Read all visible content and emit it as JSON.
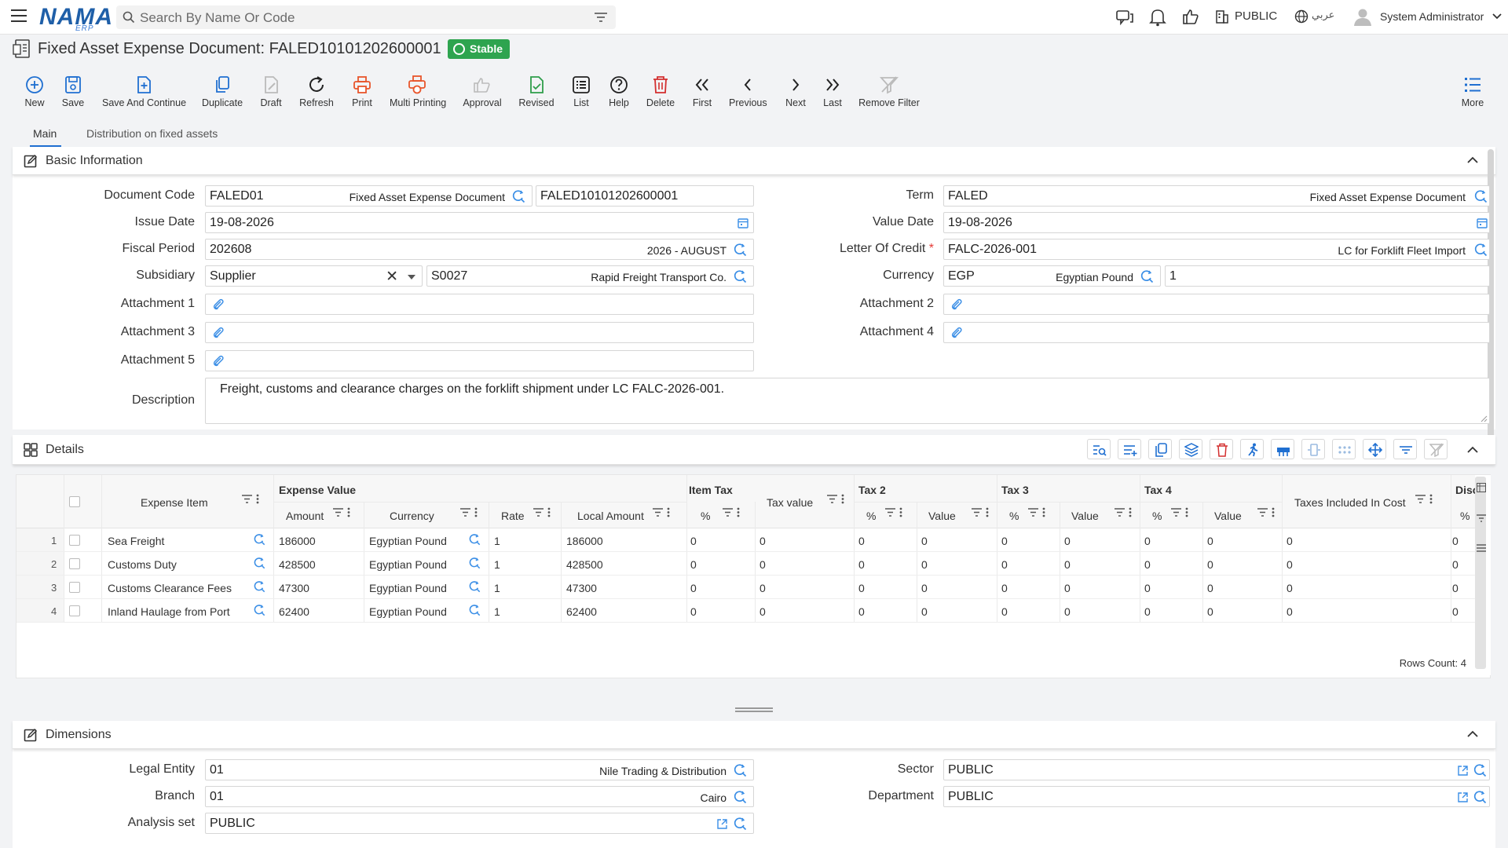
{
  "topbar": {
    "logo": "NAMA",
    "logo_sub": "ERP",
    "search_placeholder": "Search By Name Or Code",
    "company": "PUBLIC",
    "language": "عربي",
    "user": "System Administrator"
  },
  "doc": {
    "title": "Fixed Asset Expense Document: FALED10101202600001",
    "status": "Stable"
  },
  "toolbar": {
    "new": "New",
    "save": "Save",
    "save_continue": "Save And Continue",
    "duplicate": "Duplicate",
    "draft": "Draft",
    "refresh": "Refresh",
    "print": "Print",
    "multi_printing": "Multi Printing",
    "approval": "Approval",
    "revised": "Revised",
    "list": "List",
    "help": "Help",
    "delete": "Delete",
    "first": "First",
    "previous": "Previous",
    "next": "Next",
    "last": "Last",
    "remove_filter": "Remove Filter",
    "more": "More"
  },
  "tabs": {
    "main": "Main",
    "distribution": "Distribution on fixed assets"
  },
  "basic": {
    "header": "Basic Information",
    "document_code": {
      "label": "Document Code",
      "value": "FALED01",
      "desc": "Fixed Asset Expense Document",
      "code": "FALED10101202600001"
    },
    "issue_date": {
      "label": "Issue Date",
      "value": "19-08-2026"
    },
    "fiscal_period": {
      "label": "Fiscal Period",
      "value": "202608",
      "desc": "2026 - AUGUST"
    },
    "subsidiary": {
      "label": "Subsidiary",
      "type": "Supplier",
      "value": "S0027",
      "desc": "Rapid Freight Transport Co."
    },
    "attachment1": "Attachment 1",
    "attachment3": "Attachment 3",
    "attachment5": "Attachment 5",
    "term": {
      "label": "Term",
      "value": "FALED",
      "desc": "Fixed Asset Expense Document"
    },
    "value_date": {
      "label": "Value Date",
      "value": "19-08-2026"
    },
    "letter_of_credit": {
      "label": "Letter Of Credit",
      "required": "*",
      "value": "FALC-2026-001",
      "desc": "LC for Forklift Fleet Import"
    },
    "currency": {
      "label": "Currency",
      "value": "EGP",
      "desc": "Egyptian Pound",
      "rate": "1"
    },
    "attachment2": "Attachment 2",
    "attachment4": "Attachment 4",
    "description": {
      "label": "Description",
      "value": "Freight, customs and clearance charges on the forklift shipment under LC FALC-2026-001."
    }
  },
  "details": {
    "header": "Details",
    "columns": {
      "expense_item": "Expense Item",
      "expense_value": "Expense Value",
      "amount": "Amount",
      "currency": "Currency",
      "rate": "Rate",
      "local_amount": "Local Amount",
      "item_tax": "Item Tax",
      "pct": "%",
      "tax_value": "Tax value",
      "tax2": "Tax 2",
      "tax3": "Tax 3",
      "tax4": "Tax 4",
      "value": "Value",
      "taxes_included": "Taxes Included In Cost",
      "disc": "Disc"
    },
    "rows": [
      {
        "n": "1",
        "item": "Sea Freight",
        "amount": "186000",
        "currency": "Egyptian Pound",
        "rate": "1",
        "local": "186000",
        "it_pct": "0",
        "tax_value": "0",
        "t2p": "0",
        "t2v": "0",
        "t3p": "0",
        "t3v": "0",
        "t4p": "0",
        "t4v": "0",
        "incl": "0",
        "disc": "0"
      },
      {
        "n": "2",
        "item": "Customs Duty",
        "amount": "428500",
        "currency": "Egyptian Pound",
        "rate": "1",
        "local": "428500",
        "it_pct": "0",
        "tax_value": "0",
        "t2p": "0",
        "t2v": "0",
        "t3p": "0",
        "t3v": "0",
        "t4p": "0",
        "t4v": "0",
        "incl": "0",
        "disc": "0"
      },
      {
        "n": "3",
        "item": "Customs Clearance Fees",
        "amount": "47300",
        "currency": "Egyptian Pound",
        "rate": "1",
        "local": "47300",
        "it_pct": "0",
        "tax_value": "0",
        "t2p": "0",
        "t2v": "0",
        "t3p": "0",
        "t3v": "0",
        "t4p": "0",
        "t4v": "0",
        "incl": "0",
        "disc": "0"
      },
      {
        "n": "4",
        "item": "Inland Haulage from Port",
        "amount": "62400",
        "currency": "Egyptian Pound",
        "rate": "1",
        "local": "62400",
        "it_pct": "0",
        "tax_value": "0",
        "t2p": "0",
        "t2v": "0",
        "t3p": "0",
        "t3v": "0",
        "t4p": "0",
        "t4v": "0",
        "incl": "0",
        "disc": "0"
      }
    ],
    "rows_count": "Rows Count: 4"
  },
  "dimensions": {
    "header": "Dimensions",
    "legal_entity": {
      "label": "Legal Entity",
      "value": "01",
      "desc": "Nile Trading & Distribution"
    },
    "branch": {
      "label": "Branch",
      "value": "01",
      "desc": "Cairo"
    },
    "analysis_set": {
      "label": "Analysis set",
      "value": "PUBLIC"
    },
    "sector": {
      "label": "Sector",
      "value": "PUBLIC"
    },
    "department": {
      "label": "Department",
      "value": "PUBLIC"
    }
  }
}
